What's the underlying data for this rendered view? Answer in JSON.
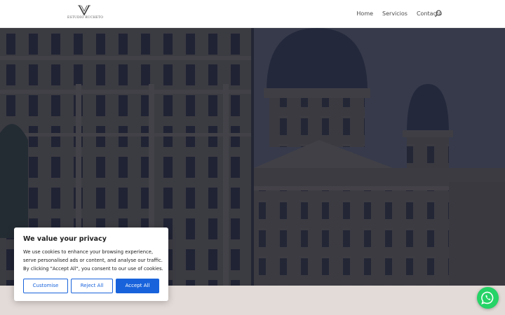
{
  "header": {
    "logo_text": "ESTUDIO RUCHETO",
    "nav": [
      "Home",
      "Servicios",
      "Contacto"
    ],
    "search_icon": "search-icon"
  },
  "hero": {
    "image": "courthouse-facade-photo",
    "overlay_color": "#1e2438"
  },
  "cookie_banner": {
    "title": "We value your privacy",
    "text": "We use cookies to enhance your browsing experience, serve personalised ads or content, and analyse our traffic. By clicking \"Accept All\", you consent to our use of cookies.",
    "customise_label": "Customise",
    "reject_label": "Reject All",
    "accept_label": "Accept All",
    "accent_color": "#1863dc"
  },
  "whatsapp": {
    "icon": "whatsapp-icon",
    "color": "#25d366"
  },
  "colors": {
    "band": "#e3dbd7",
    "nav_text": "#4a4a4a"
  }
}
